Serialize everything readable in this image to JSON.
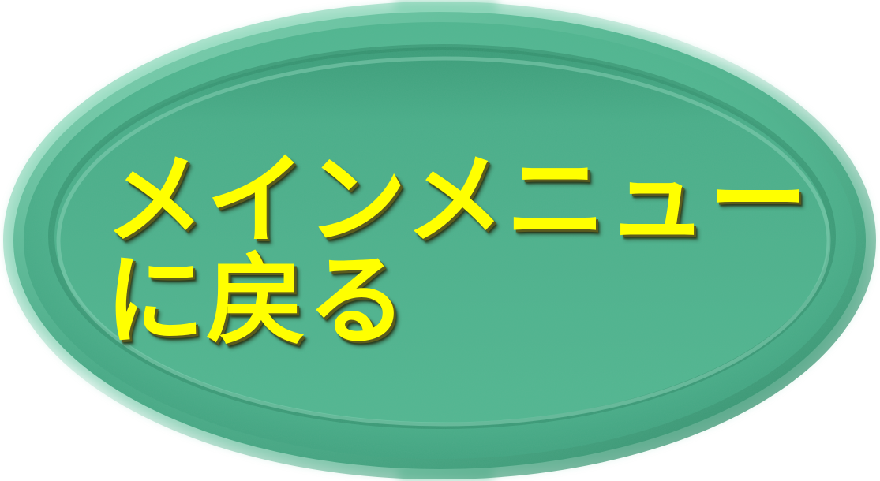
{
  "button": {
    "label_line1": "メインメニュー",
    "label_line2": "に戻る"
  },
  "colors": {
    "button_fill": "#4cb48e",
    "button_rim_light": "#8fd8bc",
    "button_rim_dark": "#2f8a68",
    "text": "#ffff00",
    "text_shadow": "#5a5a1e"
  }
}
